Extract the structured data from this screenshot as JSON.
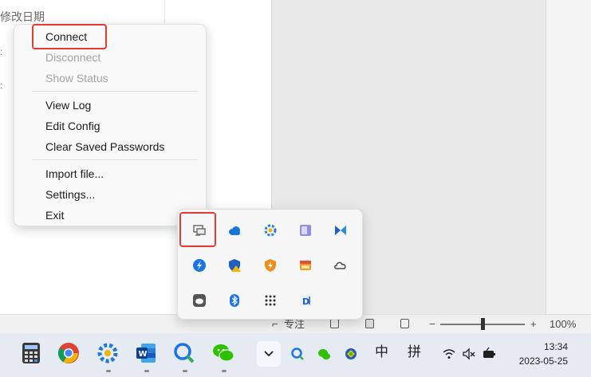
{
  "background": {
    "column_header": "修改日期"
  },
  "context_menu": {
    "items": [
      {
        "label": "Connect",
        "enabled": true,
        "highlighted": true
      },
      {
        "label": "Disconnect",
        "enabled": false
      },
      {
        "label": "Show Status",
        "enabled": false
      },
      {
        "label": "View Log",
        "enabled": true
      },
      {
        "label": "Edit Config",
        "enabled": true
      },
      {
        "label": "Clear Saved Passwords",
        "enabled": true
      },
      {
        "label": "Import file...",
        "enabled": true
      },
      {
        "label": "Settings...",
        "enabled": true
      },
      {
        "label": "Exit",
        "enabled": true
      }
    ]
  },
  "tray_flyout": {
    "icons": [
      {
        "name": "openvpn-icon",
        "highlighted": true
      },
      {
        "name": "onedrive-icon"
      },
      {
        "name": "gear-sync-icon"
      },
      {
        "name": "window-app-icon"
      },
      {
        "name": "butterfly-icon"
      },
      {
        "name": "flash-icon"
      },
      {
        "name": "shield-warning-icon"
      },
      {
        "name": "shield-orange-icon"
      },
      {
        "name": "folder-app-icon"
      },
      {
        "name": "cloud-gray-icon"
      },
      {
        "name": "cloud-app-icon"
      },
      {
        "name": "bluetooth-icon"
      },
      {
        "name": "dots-grid-icon"
      },
      {
        "name": "d-app-icon"
      }
    ]
  },
  "status_bar": {
    "focus_label": "专注",
    "zoom_out": "−",
    "zoom_in": "+",
    "zoom_level": "100%"
  },
  "taskbar": {
    "apps": [
      "calculator-icon",
      "chrome-icon",
      "settings-app-icon",
      "word-icon",
      "search-app-icon",
      "wechat-icon"
    ],
    "ime_chinese": "中",
    "ime_pinyin": "拼",
    "clock_time": "13:34",
    "clock_date": "2023-05-25"
  },
  "colors": {
    "highlight": "#e53935",
    "taskbar": "#e6ebf3",
    "menu_bg": "#f9f9f9"
  }
}
